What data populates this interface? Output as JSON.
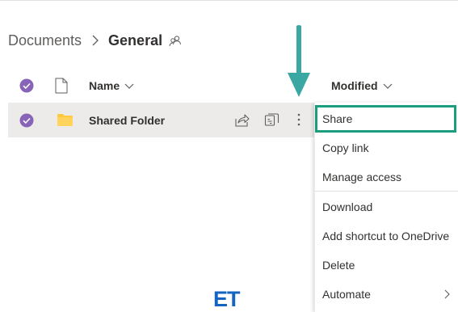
{
  "breadcrumb": {
    "root": "Documents",
    "current": "General",
    "separator_icon": "chevron-right-icon",
    "people_icon": "people-icon"
  },
  "columns": {
    "name": "Name",
    "modified": "Modified",
    "file_type_icon": "file-icon"
  },
  "row": {
    "name": "Shared Folder",
    "selected": true,
    "type_icon": "folder-icon",
    "actions": [
      "share-icon",
      "copy-link-icon",
      "more-options-icon"
    ]
  },
  "context_menu": {
    "items": [
      {
        "label": "Share",
        "highlighted": true
      },
      {
        "label": "Copy link"
      },
      {
        "label": "Manage access"
      },
      {
        "label": "Download"
      },
      {
        "label": "Add shortcut to OneDrive"
      },
      {
        "label": "Delete"
      },
      {
        "label": "Automate",
        "has_submenu": true
      }
    ]
  },
  "annotation": {
    "arrow_color": "#3aa7a3",
    "highlight_color": "#1a9e7e"
  },
  "watermark": {
    "text": "ET",
    "color": "#1565c0"
  },
  "colors": {
    "accent": "#8764b8",
    "folder": "#ffc83d",
    "selected_row": "#edebe9"
  }
}
